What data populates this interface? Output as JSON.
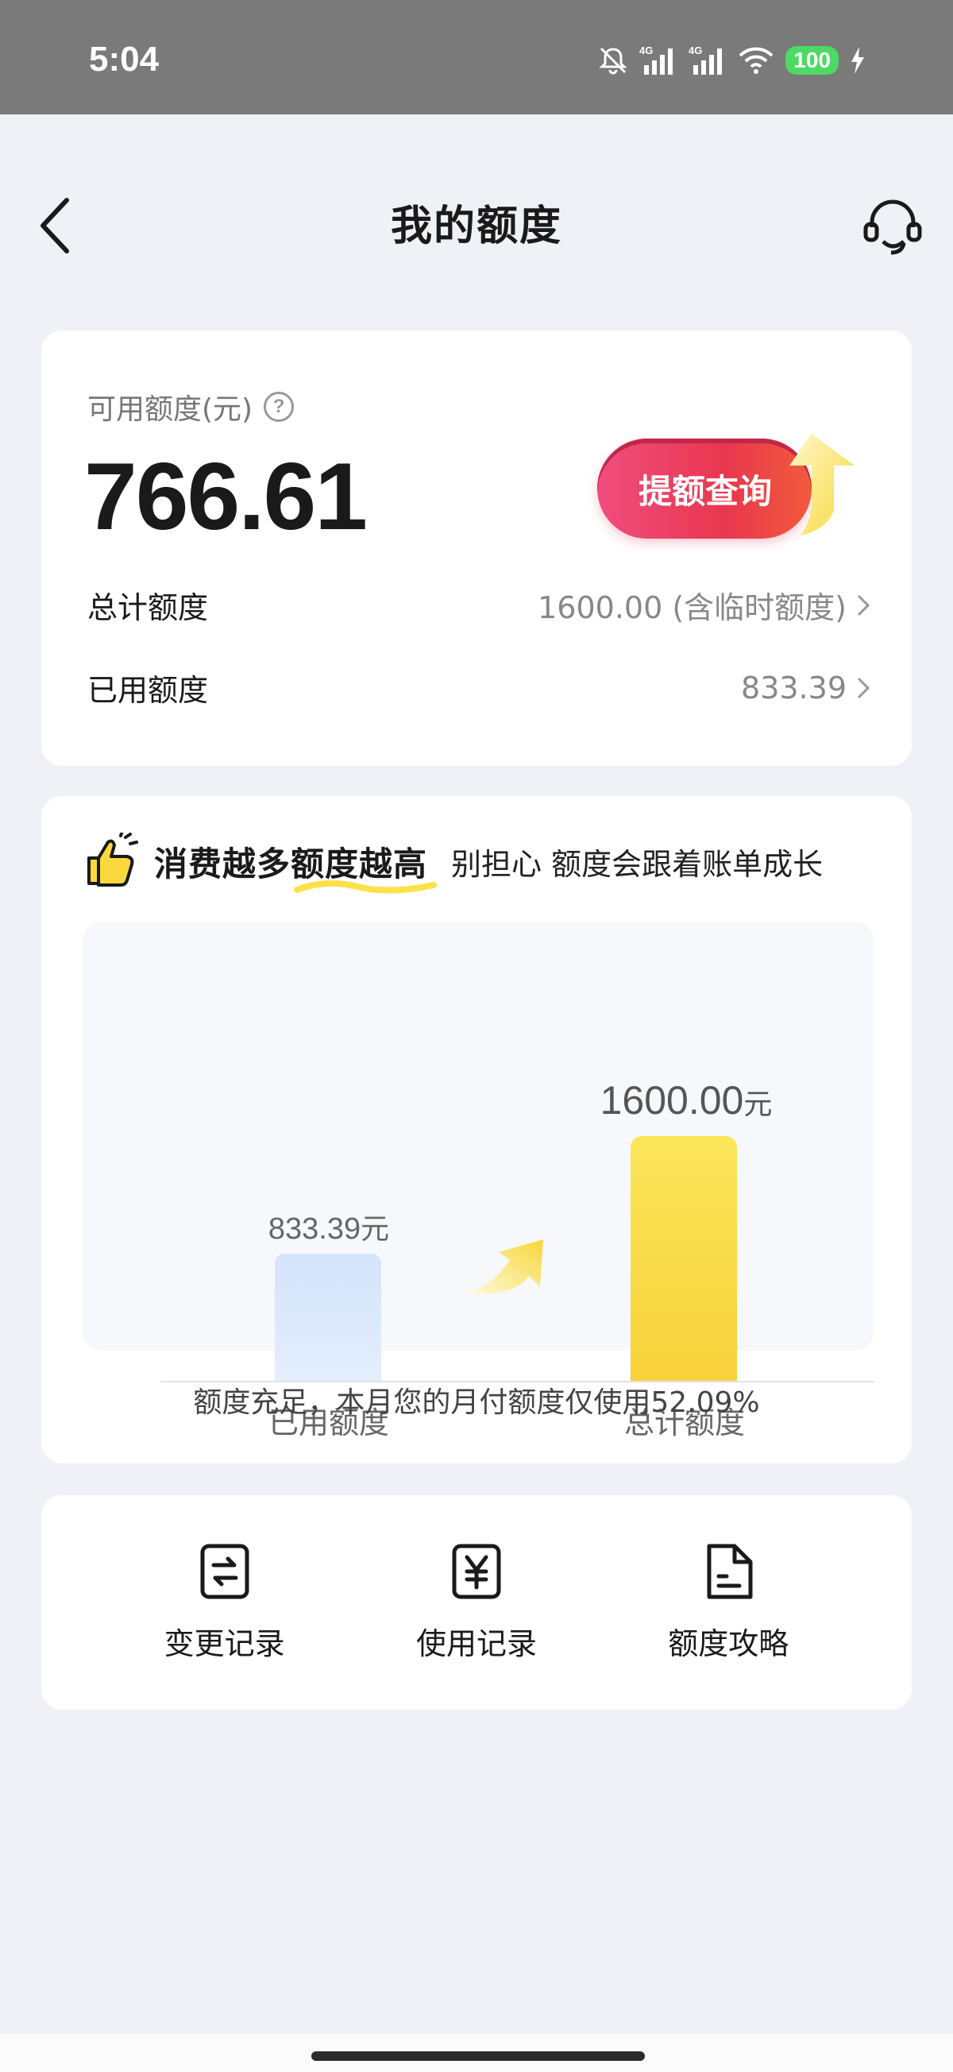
{
  "status_bar": {
    "time": "5:04",
    "battery": "100",
    "icons": [
      "bell-off-icon",
      "signal-4g-icon",
      "signal-4g-icon",
      "wifi-icon",
      "battery-icon",
      "charging-icon"
    ]
  },
  "nav": {
    "title": "我的额度",
    "back_icon": "chevron-left-icon",
    "service_icon": "headset-icon"
  },
  "quota": {
    "available_label": "可用额度(元)",
    "available_value": "766.61",
    "raise_button": "提额查询",
    "total_label": "总计额度",
    "total_value": "1600.00 (含临时额度)",
    "used_label": "已用额度",
    "used_value": "833.39"
  },
  "promo": {
    "slogan_a": "消费越多",
    "slogan_b": "额度越高",
    "sub": "别担心 额度会跟着账单成长",
    "note": "额度充足，本月您的月付额度仅使用52.09%"
  },
  "chart_data": {
    "type": "bar",
    "categories": [
      "已用额度",
      "总计额度"
    ],
    "values": [
      833.39,
      1600.0
    ],
    "value_labels": [
      "833.39",
      "1600.00"
    ],
    "unit": "元",
    "colors": [
      "#dbe8fd",
      "#f9dc45"
    ]
  },
  "actions": [
    {
      "label": "变更记录",
      "icon": "exchange-doc-icon"
    },
    {
      "label": "使用记录",
      "icon": "yuan-doc-icon"
    },
    {
      "label": "额度攻略",
      "icon": "file-doc-icon"
    }
  ]
}
